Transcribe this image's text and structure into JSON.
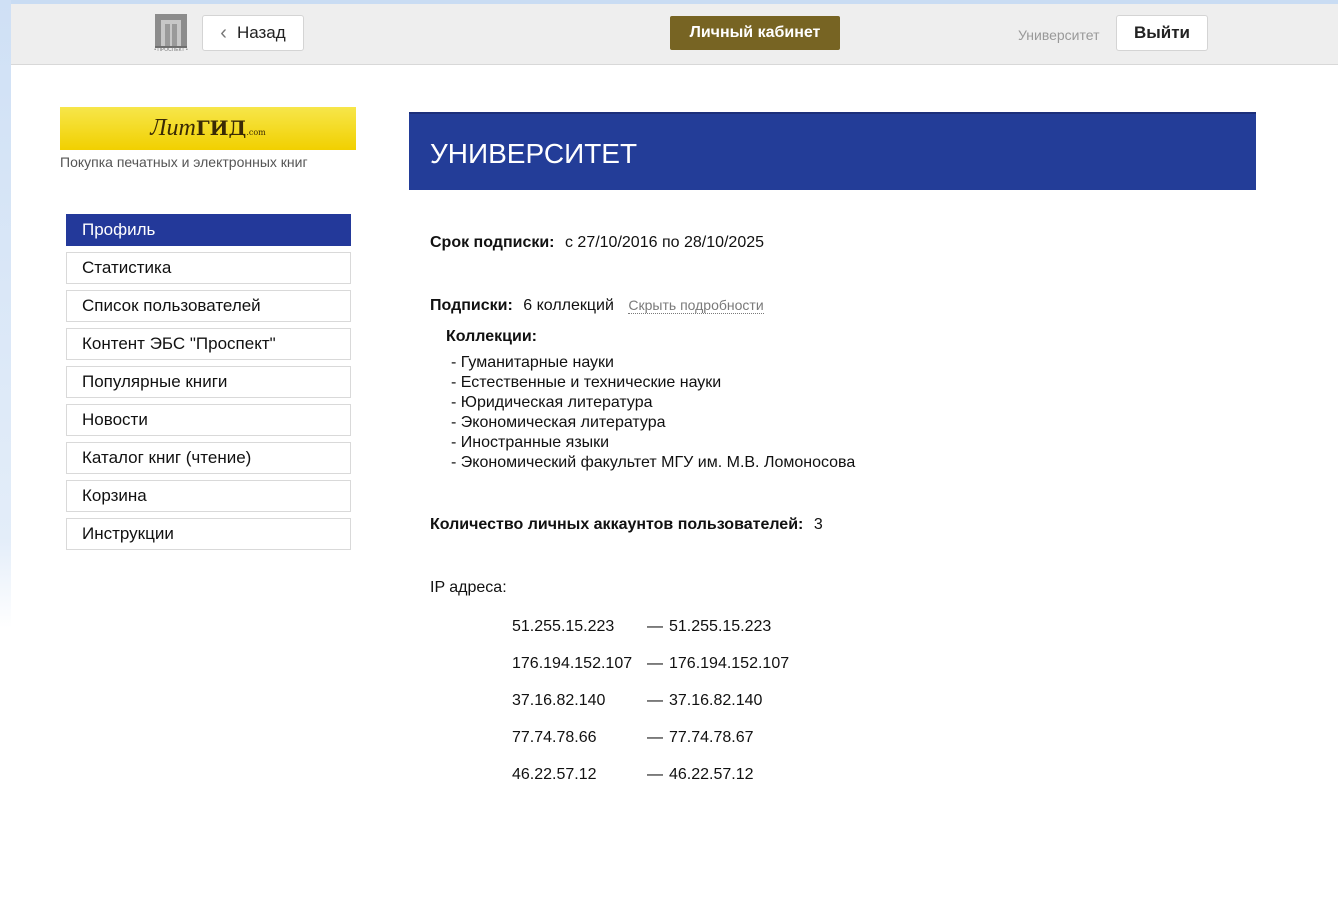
{
  "topbar": {
    "back_label": "Назад",
    "back_icon": "chevron-left-icon",
    "logo_caption": "• ПРОСПЕКТ •",
    "cabinet_label": "Личный кабинет",
    "org_name": "Университет",
    "logout_label": "Выйти"
  },
  "sidebar": {
    "banner_script": "Лит",
    "banner_bold": "ГИД",
    "banner_dotcom": ".com",
    "tagline": "Покупка печатных и электронных книг",
    "items": [
      {
        "label": "Профиль",
        "active": true
      },
      {
        "label": "Статистика"
      },
      {
        "label": "Список пользователей"
      },
      {
        "label": "Контент ЭБС \"Проспект\""
      },
      {
        "label": "Популярные книги"
      },
      {
        "label": "Новости"
      },
      {
        "label": "Каталог книг (чтение)"
      },
      {
        "label": "Корзина"
      },
      {
        "label": "Инструкции"
      }
    ]
  },
  "main": {
    "title": "УНИВЕРСИТЕТ",
    "subscription_label": "Срок подписки:",
    "subscription_value": "с 27/10/2016 по 28/10/2025",
    "subs_label": "Подписки:",
    "subs_value": "6 коллекций",
    "hide_details": "Скрыть подробности",
    "collections_label": "Коллекции:",
    "collections": [
      "- Гуманитарные науки",
      "- Естественные и технические науки",
      "- Юридическая литература",
      "- Экономическая литература",
      "- Иностранные языки",
      "- Экономический факультет МГУ им. М.В. Ломоносова"
    ],
    "accounts_label": "Количество личных аккаунтов пользователей:",
    "accounts_value": "3",
    "ip_label": "IP адреса:",
    "ip_ranges": [
      {
        "from": "51.255.15.223",
        "to": "51.255.15.223"
      },
      {
        "from": "176.194.152.107",
        "to": "176.194.152.107"
      },
      {
        "from": "37.16.82.140",
        "to": "37.16.82.140"
      },
      {
        "from": "77.74.78.66",
        "to": "77.74.78.67"
      },
      {
        "from": "46.22.57.12",
        "to": "46.22.57.12"
      }
    ],
    "ip_separator": "—"
  },
  "colors": {
    "accent_blue": "#233d98",
    "cabinet_gold": "#776423",
    "banner_yellow": "#f1d000"
  }
}
